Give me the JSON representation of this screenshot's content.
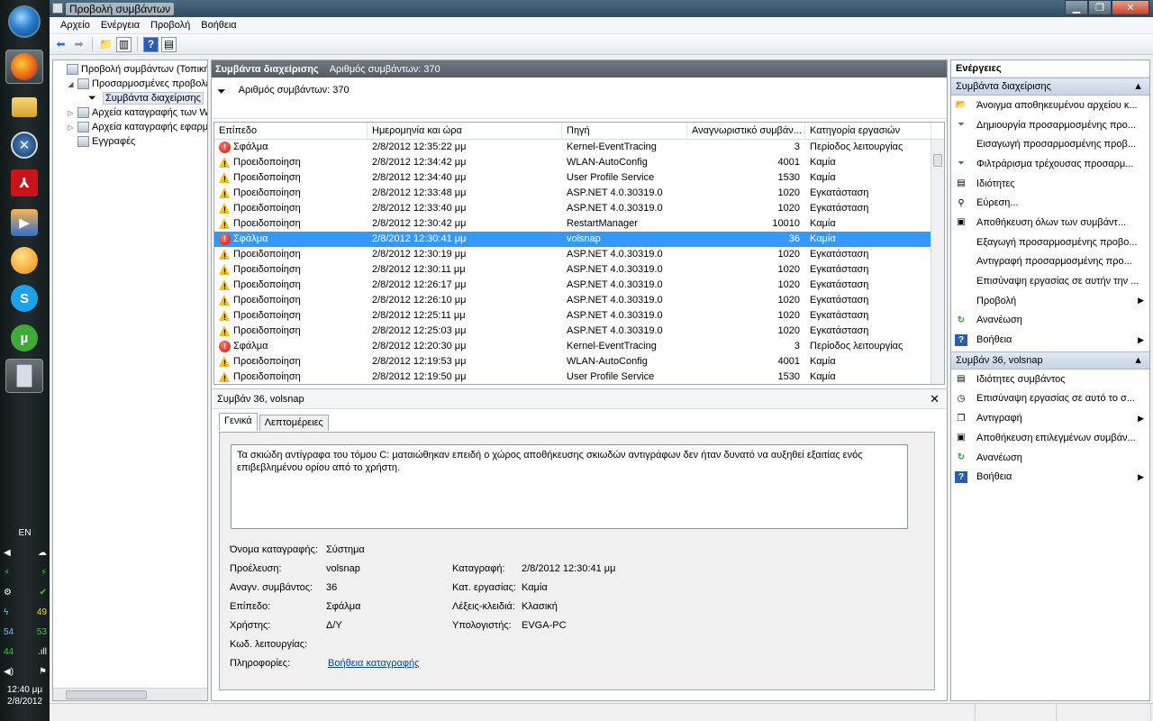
{
  "window": {
    "title": "Προβολή συμβάντων"
  },
  "menu": [
    "Αρχείο",
    "Ενέργεια",
    "Προβολή",
    "Βοήθεια"
  ],
  "tree": [
    {
      "label": "Προβολή συμβάντων (Τοπική)",
      "indent": 0,
      "twisty": ""
    },
    {
      "label": "Προσαρμοσμένες προβολές",
      "indent": 1,
      "twisty": "◢"
    },
    {
      "label": "Συμβάντα διαχείρισης",
      "indent": 2,
      "twisty": "",
      "selected": true
    },
    {
      "label": "Αρχεία καταγραφής των Windows",
      "indent": 1,
      "twisty": "▷"
    },
    {
      "label": "Αρχεία καταγραφής εφαρμογών και υπηρεσιών",
      "indent": 1,
      "twisty": "▷"
    },
    {
      "label": "Εγγραφές",
      "indent": 1,
      "twisty": ""
    }
  ],
  "center": {
    "header_title": "Συμβάντα διαχείρισης",
    "header_count": "Αριθμός συμβάντων: 370",
    "filter_text": "Αριθμός συμβάντων: 370",
    "columns": [
      "Επίπεδο",
      "Ημερομηνία και ώρα",
      "Πηγή",
      "Αναγνωριστικό συμβάν...",
      "Κατηγορία εργασιών"
    ],
    "rows": [
      {
        "level": "Σφάλμα",
        "type": "err",
        "date": "2/8/2012 12:35:22 μμ",
        "source": "Kernel-EventTracing",
        "id": "3",
        "category": "Περίοδος λειτουργίας"
      },
      {
        "level": "Προειδοποίηση",
        "type": "warn",
        "date": "2/8/2012 12:34:42 μμ",
        "source": "WLAN-AutoConfig",
        "id": "4001",
        "category": "Καμία"
      },
      {
        "level": "Προειδοποίηση",
        "type": "warn",
        "date": "2/8/2012 12:34:40 μμ",
        "source": "User Profile Service",
        "id": "1530",
        "category": "Καμία"
      },
      {
        "level": "Προειδοποίηση",
        "type": "warn",
        "date": "2/8/2012 12:33:48 μμ",
        "source": "ASP.NET 4.0.30319.0",
        "id": "1020",
        "category": "Εγκατάσταση"
      },
      {
        "level": "Προειδοποίηση",
        "type": "warn",
        "date": "2/8/2012 12:33:40 μμ",
        "source": "ASP.NET 4.0.30319.0",
        "id": "1020",
        "category": "Εγκατάσταση"
      },
      {
        "level": "Προειδοποίηση",
        "type": "warn",
        "date": "2/8/2012 12:30:42 μμ",
        "source": "RestartManager",
        "id": "10010",
        "category": "Καμία"
      },
      {
        "level": "Σφάλμα",
        "type": "err",
        "date": "2/8/2012 12:30:41 μμ",
        "source": "volsnap",
        "id": "36",
        "category": "Καμία",
        "selected": true
      },
      {
        "level": "Προειδοποίηση",
        "type": "warn",
        "date": "2/8/2012 12:30:19 μμ",
        "source": "ASP.NET 4.0.30319.0",
        "id": "1020",
        "category": "Εγκατάσταση"
      },
      {
        "level": "Προειδοποίηση",
        "type": "warn",
        "date": "2/8/2012 12:30:11 μμ",
        "source": "ASP.NET 4.0.30319.0",
        "id": "1020",
        "category": "Εγκατάσταση"
      },
      {
        "level": "Προειδοποίηση",
        "type": "warn",
        "date": "2/8/2012 12:26:17 μμ",
        "source": "ASP.NET 4.0.30319.0",
        "id": "1020",
        "category": "Εγκατάσταση"
      },
      {
        "level": "Προειδοποίηση",
        "type": "warn",
        "date": "2/8/2012 12:26:10 μμ",
        "source": "ASP.NET 4.0.30319.0",
        "id": "1020",
        "category": "Εγκατάσταση"
      },
      {
        "level": "Προειδοποίηση",
        "type": "warn",
        "date": "2/8/2012 12:25:11 μμ",
        "source": "ASP.NET 4.0.30319.0",
        "id": "1020",
        "category": "Εγκατάσταση"
      },
      {
        "level": "Προειδοποίηση",
        "type": "warn",
        "date": "2/8/2012 12:25:03 μμ",
        "source": "ASP.NET 4.0.30319.0",
        "id": "1020",
        "category": "Εγκατάσταση"
      },
      {
        "level": "Σφάλμα",
        "type": "err",
        "date": "2/8/2012 12:20:30 μμ",
        "source": "Kernel-EventTracing",
        "id": "3",
        "category": "Περίοδος λειτουργίας"
      },
      {
        "level": "Προειδοποίηση",
        "type": "warn",
        "date": "2/8/2012 12:19:53 μμ",
        "source": "WLAN-AutoConfig",
        "id": "4001",
        "category": "Καμία"
      },
      {
        "level": "Προειδοποίηση",
        "type": "warn",
        "date": "2/8/2012 12:19:50 μμ",
        "source": "User Profile Service",
        "id": "1530",
        "category": "Καμία"
      }
    ]
  },
  "detail": {
    "title": "Συμβάν 36, volsnap",
    "tab_general": "Γενικά",
    "tab_details": "Λεπτομέρειες",
    "description": "Τα σκιώδη αντίγραφα του τόμου C: ματαιώθηκαν επειδή ο χώρος αποθήκευσης σκιωδών αντιγράφων δεν ήταν δυνατό να αυξηθεί εξαιτίας ενός επιβεβλημένου ορίου από το χρήστη.",
    "log_name_label": "Όνομα καταγραφής:",
    "log_name": "Σύστημα",
    "source_label": "Προέλευση:",
    "source": "volsnap",
    "logged_label": "Καταγραφή:",
    "logged": "2/8/2012 12:30:41 μμ",
    "event_id_label": "Αναγν. συμβάντος:",
    "event_id": "36",
    "task_label": "Κατ. εργασίας:",
    "task": "Καμία",
    "level_label": "Επίπεδο:",
    "level": "Σφάλμα",
    "keywords_label": "Λέξεις-κλειδιά:",
    "keywords": "Κλασική",
    "user_label": "Χρήστης:",
    "user": "Δ/Υ",
    "computer_label": "Υπολογιστής:",
    "computer": "EVGA-PC",
    "opcode_label": "Κωδ. λειτουργίας:",
    "more_info_label": "Πληροφορίες:",
    "more_info_link": "Βοήθεια καταγραφής"
  },
  "actions": {
    "title": "Ενέργειες",
    "section1": "Συμβάντα διαχείρισης",
    "items1": [
      {
        "label": "Άνοιγμα αποθηκευμένου αρχείου κ...",
        "icon": "open-folder-icon",
        "glyph": "📂",
        "arrow": false
      },
      {
        "label": "Δημιουργία προσαρμοσμένης προ...",
        "icon": "filter-icon",
        "glyph": "⏷",
        "arrow": false
      },
      {
        "label": "Εισαγωγή προσαρμοσμένης προβ...",
        "icon": "",
        "glyph": "",
        "arrow": false
      },
      {
        "label": "Φιλτράρισμα τρέχουσας προσαρμ...",
        "icon": "filter-icon",
        "glyph": "⏷",
        "arrow": false
      },
      {
        "label": "Ιδιότητες",
        "icon": "properties-icon",
        "glyph": "▤",
        "arrow": false
      },
      {
        "label": "Εύρεση...",
        "icon": "find-icon",
        "glyph": "⚲",
        "arrow": false
      },
      {
        "label": "Αποθήκευση όλων των συμβάντ...",
        "icon": "save-icon",
        "glyph": "▣",
        "arrow": false
      },
      {
        "label": "Εξαγωγή προσαρμοσμένης προβο...",
        "icon": "",
        "glyph": "",
        "arrow": false
      },
      {
        "label": "Αντιγραφή προσαρμοσμένης προ...",
        "icon": "",
        "glyph": "",
        "arrow": false
      },
      {
        "label": "Επισύναψη εργασίας σε αυτήν την ...",
        "icon": "",
        "glyph": "",
        "arrow": false
      },
      {
        "label": "Προβολή",
        "icon": "",
        "glyph": "",
        "arrow": true
      },
      {
        "label": "Ανανέωση",
        "icon": "refresh-icon",
        "glyph": "↻",
        "arrow": false
      },
      {
        "label": "Βοήθεια",
        "icon": "help-icon",
        "glyph": "?",
        "arrow": true
      }
    ],
    "section2": "Συμβάν 36, volsnap",
    "items2": [
      {
        "label": "Ιδιότητες συμβάντος",
        "icon": "properties-icon",
        "glyph": "▤",
        "arrow": false
      },
      {
        "label": "Επισύναψη εργασίας σε αυτό το σ...",
        "icon": "task-icon",
        "glyph": "◷",
        "arrow": false
      },
      {
        "label": "Αντιγραφή",
        "icon": "copy-icon",
        "glyph": "❐",
        "arrow": true
      },
      {
        "label": "Αποθήκευση επιλεγμένων συμβάν...",
        "icon": "save-icon",
        "glyph": "▣",
        "arrow": false
      },
      {
        "label": "Ανανέωση",
        "icon": "refresh-icon",
        "glyph": "↻",
        "arrow": false
      },
      {
        "label": "Βοήθεια",
        "icon": "help-icon",
        "glyph": "?",
        "arrow": true
      }
    ]
  },
  "taskbar": {
    "lang": "EN",
    "tray_values": [
      "49",
      "54",
      "53",
      "44"
    ],
    "clock_time": "12:40 μμ",
    "clock_date": "2/8/2012"
  }
}
